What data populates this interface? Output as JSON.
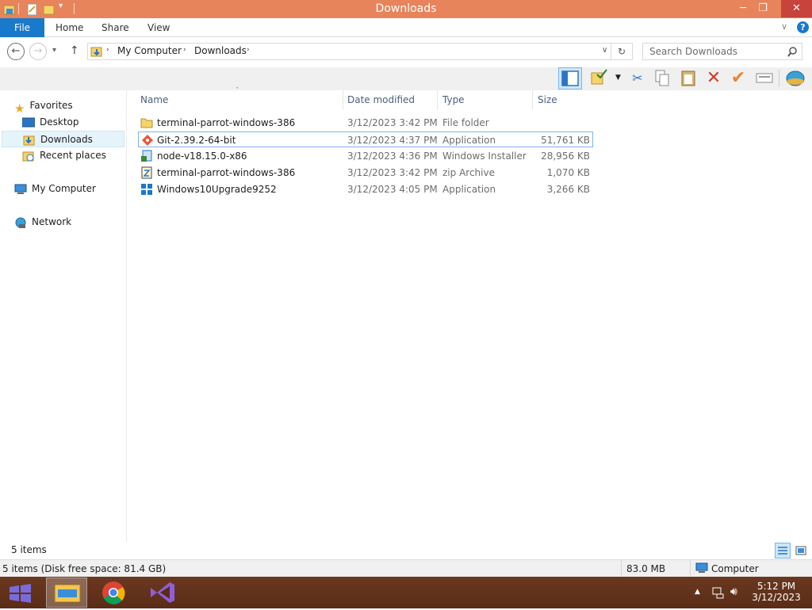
{
  "window": {
    "title": "Downloads"
  },
  "ribbon": {
    "file": "File",
    "tabs": [
      "Home",
      "Share",
      "View"
    ]
  },
  "address": {
    "segments": [
      "My Computer",
      "Downloads"
    ]
  },
  "search": {
    "placeholder": "Search Downloads"
  },
  "sidebar": {
    "favorites": "Favorites",
    "desktop": "Desktop",
    "downloads": "Downloads",
    "recent": "Recent places",
    "computer": "My Computer",
    "network": "Network"
  },
  "columns": {
    "name": "Name",
    "date": "Date modified",
    "type": "Type",
    "size": "Size"
  },
  "files": [
    {
      "name": "terminal-parrot-windows-386",
      "date": "3/12/2023 3:42 PM",
      "type": "File folder",
      "size": "",
      "icon": "folder-icon"
    },
    {
      "name": "Git-2.39.2-64-bit",
      "date": "3/12/2023 4:37 PM",
      "type": "Application",
      "size": "51,761 KB",
      "icon": "git-icon"
    },
    {
      "name": "node-v18.15.0-x86",
      "date": "3/12/2023 4:36 PM",
      "type": "Windows Installer ...",
      "size": "28,956 KB",
      "icon": "installer-icon"
    },
    {
      "name": "terminal-parrot-windows-386",
      "date": "3/12/2023 3:42 PM",
      "type": "zip Archive",
      "size": "1,070 KB",
      "icon": "zip-icon"
    },
    {
      "name": "Windows10Upgrade9252",
      "date": "3/12/2023 4:05 PM",
      "type": "Application",
      "size": "3,266 KB",
      "icon": "windows-logo-icon"
    }
  ],
  "status": {
    "items": "5 items",
    "disk": "5 items (Disk free space: 81.4 GB)",
    "size": "83.0 MB",
    "location": "Computer"
  },
  "clock": {
    "time": "5:12 PM",
    "date": "3/12/2023"
  },
  "colors": {
    "titlebar": "#e8845b",
    "file_tab": "#1979ca",
    "taskbar": "#5a2c16",
    "selection": "#7eb4ea"
  }
}
